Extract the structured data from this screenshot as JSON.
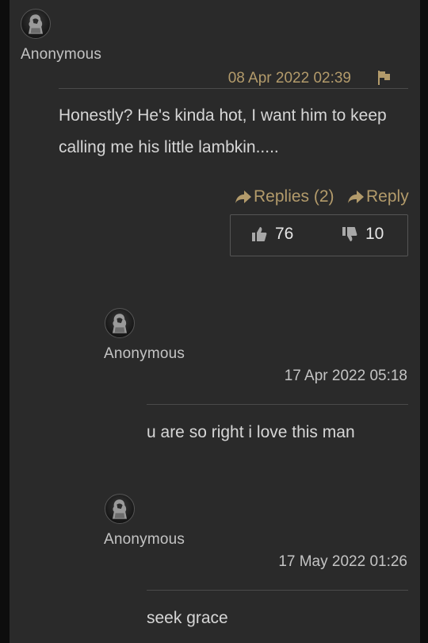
{
  "comment": {
    "author": "Anonymous",
    "date": "08 Apr 2022 02:39",
    "text": "Honestly? He's kinda hot, I want him to keep calling me his little lambkin.....",
    "replies_label": "Replies (2)",
    "reply_label": "Reply",
    "upvotes": "76",
    "downvotes": "10"
  },
  "replies": [
    {
      "author": "Anonymous",
      "date": "17 Apr 2022 05:18",
      "text": "u are so right i love this man"
    },
    {
      "author": "Anonymous",
      "date": "17 May 2022 01:26",
      "text": "seek grace"
    }
  ],
  "colors": {
    "accent": "#b39b6b",
    "background": "#2a2a2a",
    "text": "#d6d6d6"
  },
  "icons": [
    "avatar-icon",
    "flag-icon",
    "reply-arrow-icon",
    "thumbs-up-icon",
    "thumbs-down-icon"
  ]
}
